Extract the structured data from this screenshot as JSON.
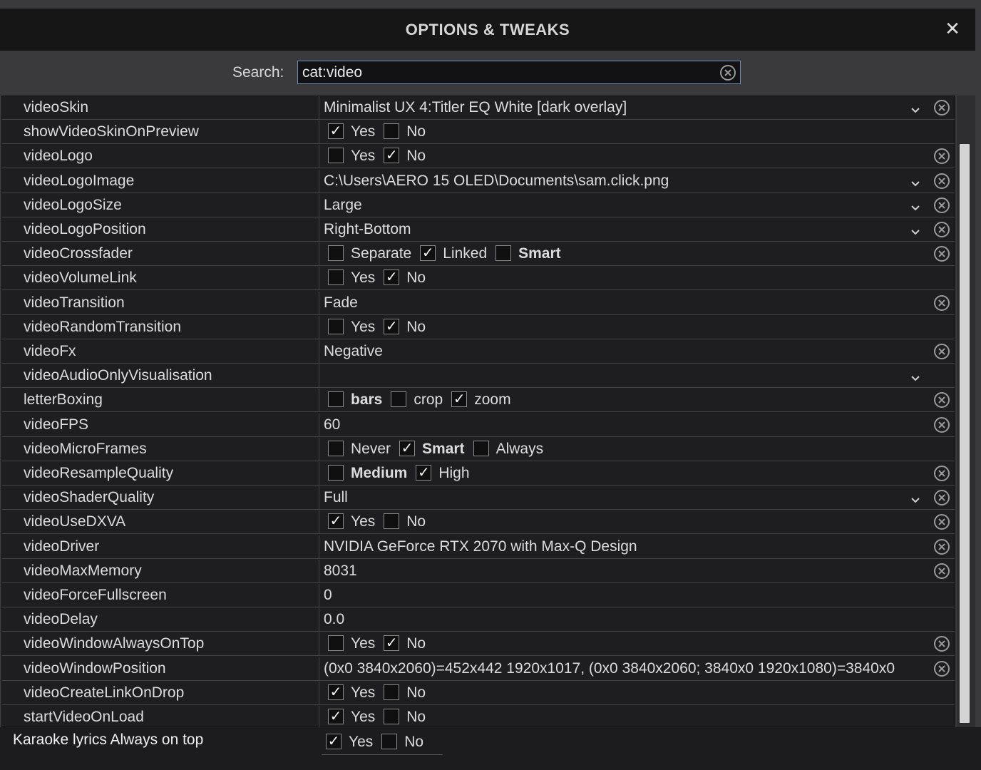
{
  "dialog": {
    "title": "OPTIONS & TWEAKS",
    "close_glyph": "✕"
  },
  "search": {
    "label": "Search:",
    "value": "cat:video"
  },
  "rows": [
    {
      "name": "videoSkin",
      "type": "select",
      "value": "Minimalist UX 4:Titler EQ White [dark overlay]",
      "clear": true
    },
    {
      "name": "showVideoSkinOnPreview",
      "type": "check",
      "options": [
        {
          "label": "Yes",
          "checked": true
        },
        {
          "label": "No",
          "checked": false
        }
      ],
      "clear": false
    },
    {
      "name": "videoLogo",
      "type": "check",
      "options": [
        {
          "label": "Yes",
          "checked": false
        },
        {
          "label": "No",
          "checked": true
        }
      ],
      "clear": true
    },
    {
      "name": "videoLogoImage",
      "type": "select",
      "value": "C:\\Users\\AERO 15 OLED\\Documents\\sam.click.png",
      "clear": true
    },
    {
      "name": "videoLogoSize",
      "type": "select",
      "value": "Large",
      "clear": true
    },
    {
      "name": "videoLogoPosition",
      "type": "select",
      "value": "Right-Bottom",
      "clear": true
    },
    {
      "name": "videoCrossfader",
      "type": "check",
      "options": [
        {
          "label": "Separate",
          "checked": false
        },
        {
          "label": "Linked",
          "checked": true
        },
        {
          "label": "Smart",
          "checked": false,
          "bold": true
        }
      ],
      "clear": true
    },
    {
      "name": "videoVolumeLink",
      "type": "check",
      "options": [
        {
          "label": "Yes",
          "checked": false
        },
        {
          "label": "No",
          "checked": true
        }
      ],
      "clear": false
    },
    {
      "name": "videoTransition",
      "type": "text",
      "value": "Fade",
      "clear": true
    },
    {
      "name": "videoRandomTransition",
      "type": "check",
      "options": [
        {
          "label": "Yes",
          "checked": false
        },
        {
          "label": "No",
          "checked": true
        }
      ],
      "clear": false
    },
    {
      "name": "videoFx",
      "type": "text",
      "value": "Negative",
      "clear": true
    },
    {
      "name": "videoAudioOnlyVisualisation",
      "type": "select",
      "value": "",
      "clear": false
    },
    {
      "name": "letterBoxing",
      "type": "check",
      "options": [
        {
          "label": "bars",
          "checked": false,
          "bold": true
        },
        {
          "label": "crop",
          "checked": false
        },
        {
          "label": "zoom",
          "checked": true
        }
      ],
      "clear": true
    },
    {
      "name": "videoFPS",
      "type": "text",
      "value": "60",
      "clear": true
    },
    {
      "name": "videoMicroFrames",
      "type": "check",
      "options": [
        {
          "label": "Never",
          "checked": false
        },
        {
          "label": "Smart",
          "checked": true,
          "bold": true
        },
        {
          "label": "Always",
          "checked": false
        }
      ],
      "clear": false
    },
    {
      "name": "videoResampleQuality",
      "type": "check",
      "options": [
        {
          "label": "Medium",
          "checked": false,
          "bold": true
        },
        {
          "label": "High",
          "checked": true
        }
      ],
      "clear": true
    },
    {
      "name": "videoShaderQuality",
      "type": "select",
      "value": "Full",
      "clear": true
    },
    {
      "name": "videoUseDXVA",
      "type": "check",
      "options": [
        {
          "label": "Yes",
          "checked": true
        },
        {
          "label": "No",
          "checked": false
        }
      ],
      "clear": true
    },
    {
      "name": "videoDriver",
      "type": "text",
      "value": "NVIDIA GeForce RTX 2070 with Max-Q Design",
      "clear": true
    },
    {
      "name": "videoMaxMemory",
      "type": "text",
      "value": "8031",
      "clear": true
    },
    {
      "name": "videoForceFullscreen",
      "type": "text",
      "value": "0",
      "clear": false
    },
    {
      "name": "videoDelay",
      "type": "text",
      "value": "0.0",
      "clear": false
    },
    {
      "name": "videoWindowAlwaysOnTop",
      "type": "check",
      "options": [
        {
          "label": "Yes",
          "checked": false
        },
        {
          "label": "No",
          "checked": true
        }
      ],
      "clear": true
    },
    {
      "name": "videoWindowPosition",
      "type": "text",
      "value": "(0x0 3840x2060)=452x442 1920x1017, (0x0 3840x2060; 3840x0 1920x1080)=3840x0",
      "clear": true
    },
    {
      "name": "videoCreateLinkOnDrop",
      "type": "check",
      "options": [
        {
          "label": "Yes",
          "checked": true
        },
        {
          "label": "No",
          "checked": false
        }
      ],
      "clear": false
    },
    {
      "name": "startVideoOnLoad",
      "type": "check",
      "options": [
        {
          "label": "Yes",
          "checked": true
        },
        {
          "label": "No",
          "checked": false
        }
      ],
      "clear": false
    }
  ],
  "footer": {
    "label": "Karaoke lyrics Always on top",
    "options": [
      {
        "label": "Yes",
        "checked": true
      },
      {
        "label": "No",
        "checked": false
      }
    ]
  },
  "check_glyph": "✓",
  "colors": {
    "dialog_bg": "#3a3a3c",
    "titlebar_bg": "#161617",
    "table_bg": "#1e1e20",
    "search_border": "#6f8fb6"
  }
}
